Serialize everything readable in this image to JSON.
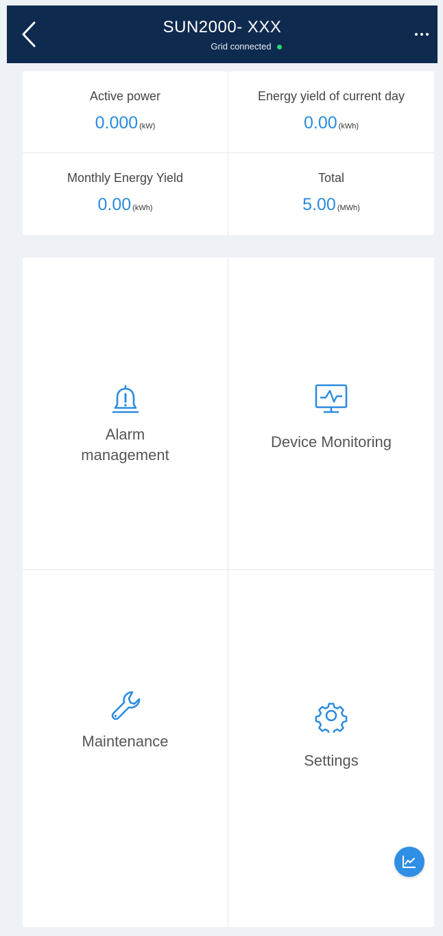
{
  "header": {
    "title": "SUN2000- XXX",
    "status": "Grid connected",
    "status_color": "#2bd36b",
    "bg_color": "#0f2a4f",
    "back_icon": "chevron-left-icon",
    "more_icon": "more-horizontal-icon"
  },
  "stats": [
    {
      "label": "Active power",
      "value": "0.000",
      "unit": "(kW)"
    },
    {
      "label": "Energy yield of current day",
      "value": "0.00",
      "unit": "(kWh)"
    },
    {
      "label": "Monthly Energy Yield",
      "value": "0.00",
      "unit": "(kWh)"
    },
    {
      "label": "Total",
      "value": "5.00",
      "unit": "(MWh)"
    }
  ],
  "accent_color": "#2a8be0",
  "menu": [
    {
      "label": "Alarm management",
      "icon": "bell-alert-icon"
    },
    {
      "label": "Device Monitoring",
      "icon": "monitor-chart-icon"
    },
    {
      "label": "Maintenance",
      "icon": "wrench-icon"
    },
    {
      "label": "Settings",
      "icon": "gear-icon"
    }
  ],
  "fab": {
    "icon": "trend-chart-icon"
  }
}
